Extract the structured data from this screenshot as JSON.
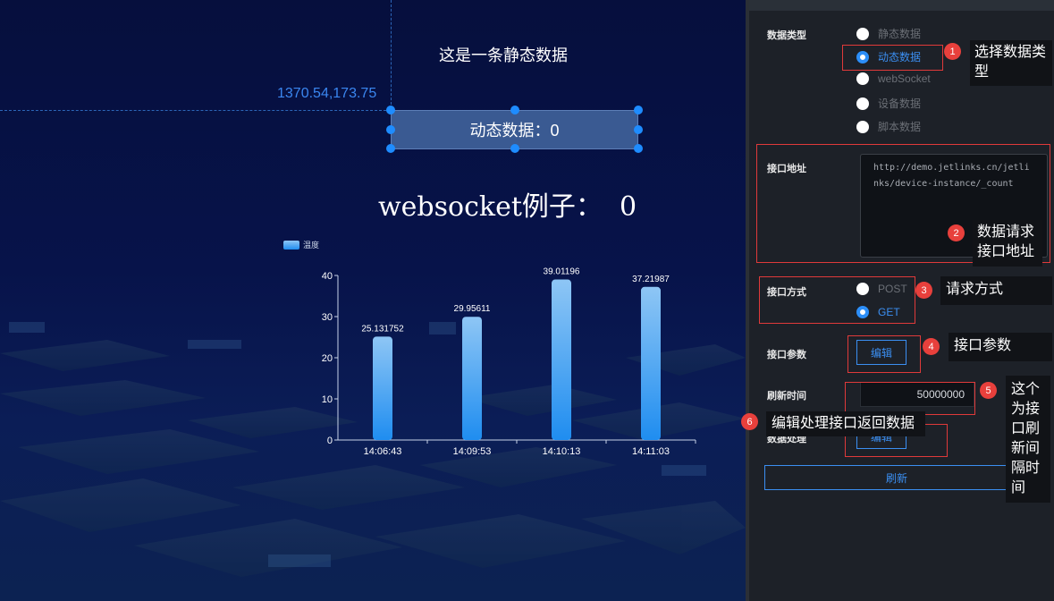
{
  "canvas": {
    "guide_coord": "1370.54,173.75",
    "static_title": "这是一条静态数据",
    "dynamic_label": "动态数据：0",
    "websocket_label": "websocket例子：  0"
  },
  "chart_data": {
    "type": "bar",
    "legend": [
      "温度"
    ],
    "legend_position": "top-left",
    "categories": [
      "14:06:43",
      "14:09:53",
      "14:10:13",
      "14:11:03"
    ],
    "series": [
      {
        "name": "温度",
        "values": [
          25.131752,
          29.95611,
          39.01196,
          37.21987
        ]
      }
    ],
    "data_labels": [
      "25.131752",
      "29.95611",
      "39.01196",
      "37.21987"
    ],
    "ylim": [
      0,
      40
    ],
    "yticks": [
      0,
      10,
      20,
      30,
      40
    ],
    "grid": false,
    "colors": {
      "bar_top": "#8ec6f5",
      "bar_bottom": "#1f8df0",
      "axis": "#c7d2e8",
      "text": "#ffffff"
    }
  },
  "panel": {
    "data_type_label": "数据类型",
    "data_type_options": [
      {
        "label": "静态数据",
        "selected": false
      },
      {
        "label": "动态数据",
        "selected": true
      },
      {
        "label": "webSocket",
        "selected": false
      },
      {
        "label": "设备数据",
        "selected": false
      },
      {
        "label": "脚本数据",
        "selected": false
      }
    ],
    "api_url_label": "接口地址",
    "api_url_value": "http://demo.jetlinks.cn/jetlinks/device-instance/_count",
    "method_label": "接口方式",
    "method_options": [
      {
        "label": "POST",
        "selected": false
      },
      {
        "label": "GET",
        "selected": true
      }
    ],
    "params_label": "接口参数",
    "params_button": "编辑",
    "refresh_time_label": "刷新时间",
    "refresh_time_value": "50000000",
    "data_processing_label": "数据处理",
    "data_processing_button": "编辑",
    "refresh_button": "刷新"
  },
  "annotations": [
    {
      "number": "1",
      "text": "选择数据类型"
    },
    {
      "number": "2",
      "text": "数据请求接口地址"
    },
    {
      "number": "3",
      "text": "请求方式"
    },
    {
      "number": "4",
      "text": "接口参数"
    },
    {
      "number": "5",
      "text": "这个为接口刷新间隔时间"
    },
    {
      "number": "6",
      "text": "编辑处理接口返回数据"
    }
  ],
  "colors": {
    "accent": "#3b8ff2",
    "annotation_red": "#e8403c",
    "panel_bg": "#1d2128"
  }
}
